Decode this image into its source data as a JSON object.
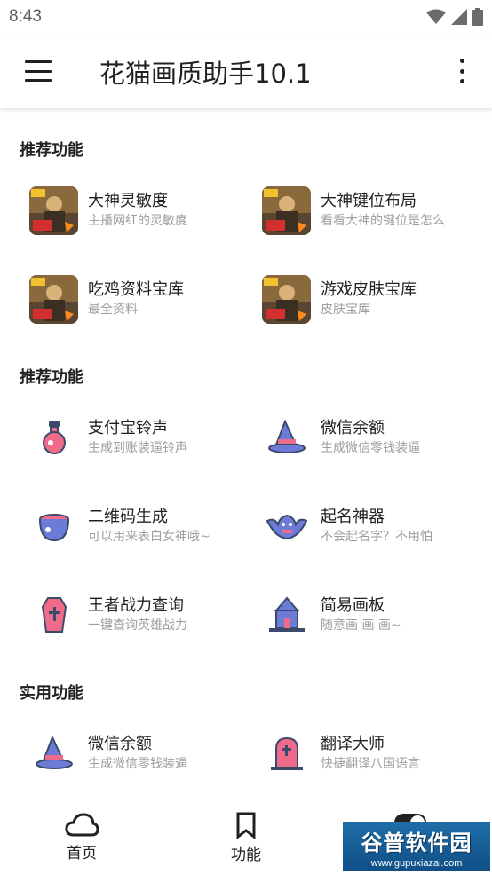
{
  "status_bar": {
    "time": "8:43"
  },
  "app_bar": {
    "title": "花猫画质助手10.1"
  },
  "sections": [
    {
      "title": "推荐功能"
    },
    {
      "title": "推荐功能"
    },
    {
      "title": "实用功能"
    }
  ],
  "games": [
    {
      "title": "大神灵敏度",
      "subtitle": "主播网红的灵敏度"
    },
    {
      "title": "大神键位布局",
      "subtitle": "看看大神的键位是怎么"
    },
    {
      "title": "吃鸡资料宝库",
      "subtitle": "最全资料"
    },
    {
      "title": "游戏皮肤宝库",
      "subtitle": "皮肤宝库"
    }
  ],
  "tools": [
    {
      "title": "支付宝铃声",
      "subtitle": "生成到账装逼铃声",
      "icon": "potion-icon"
    },
    {
      "title": "微信余额",
      "subtitle": "生成微信零钱装逼",
      "icon": "wizard-hat-icon"
    },
    {
      "title": "二维码生成",
      "subtitle": "可以用来表白女神哦~",
      "icon": "cauldron-icon"
    },
    {
      "title": "起名神器",
      "subtitle": "不会起名字？不用怕",
      "icon": "bat-icon"
    },
    {
      "title": "王者战力查询",
      "subtitle": "一键查询英雄战力",
      "icon": "coffin-icon"
    },
    {
      "title": "简易画板",
      "subtitle": "随意画 画 画~",
      "icon": "haunted-house-icon"
    }
  ],
  "utilities": [
    {
      "title": "微信余额",
      "subtitle": "生成微信零钱装逼",
      "icon": "wizard-hat-icon"
    },
    {
      "title": "翻译大师",
      "subtitle": "快捷翻译八国语言",
      "icon": "tombstone-icon"
    }
  ],
  "bottom_nav": [
    {
      "label": "首页",
      "icon": "cloud-icon"
    },
    {
      "label": "功能",
      "icon": "bookmark-icon"
    },
    {
      "label": "",
      "icon": "toggle-icon"
    }
  ],
  "watermark": {
    "title": "谷普软件园",
    "url": "www.gupuxiazai.com"
  },
  "colors": {
    "accent_dark": "#3a4a6b",
    "icon_pink": "#f06a8a",
    "icon_blue": "#6b7bd6",
    "subtitle_gray": "#9e9e9e"
  }
}
